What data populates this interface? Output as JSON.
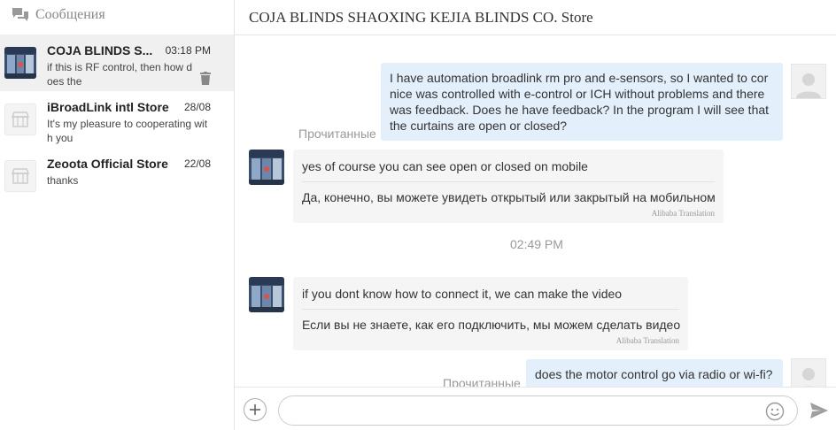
{
  "sidebar": {
    "title": "Сообщения",
    "conversations": [
      {
        "name": "COJA BLINDS S...",
        "time": "03:18 PM",
        "preview": "if this is RF control, then how does the",
        "active": true
      },
      {
        "name": "iBroadLink intl Store",
        "time": "28/08",
        "preview": "It's my pleasure to cooperating wit h you",
        "active": false
      },
      {
        "name": "Zeoota Official Store",
        "time": "22/08",
        "preview": "thanks",
        "active": false
      }
    ]
  },
  "chat": {
    "store_name": "COJA BLINDS SHAOXING KEJIA BLINDS CO. Store",
    "read_label": "Прочитанные",
    "translation_credit": "Alibaba Translation",
    "messages": [
      {
        "from": "me",
        "text": "I have automation broadlink rm pro and e-sensors, so I wanted to cor nice was controlled with e-control or ICH without problems and there was feedback. Does he have feedback? In the program I will see that the curtains are open or closed?",
        "status": "Прочитанные"
      },
      {
        "from": "seller",
        "text": "yes of course you can see open or closed on mobile",
        "translation": "Да, конечно, вы можете увидеть открытый или закрытый на мобильном"
      },
      {
        "time": "02:49 PM"
      },
      {
        "from": "seller",
        "text": "if you dont know how to connect it, we can make the video",
        "translation": "Если вы не знаете, как его подключить, мы можем сделать видео"
      },
      {
        "from": "me",
        "text": "does the motor control go via radio or wi-fi?",
        "status": "Прочитанные"
      }
    ],
    "input": {
      "value": "",
      "placeholder": ""
    }
  },
  "colors": {
    "outgoing_bubble": "#e3effb",
    "incoming_bubble": "#f5f5f5",
    "active_conversation": "#f0f0f0"
  },
  "icons": {
    "header": "chat-bubbles-icon",
    "delete": "trash-icon",
    "attach": "plus-icon",
    "emoji": "smiley-icon",
    "send": "send-arrow-icon"
  }
}
